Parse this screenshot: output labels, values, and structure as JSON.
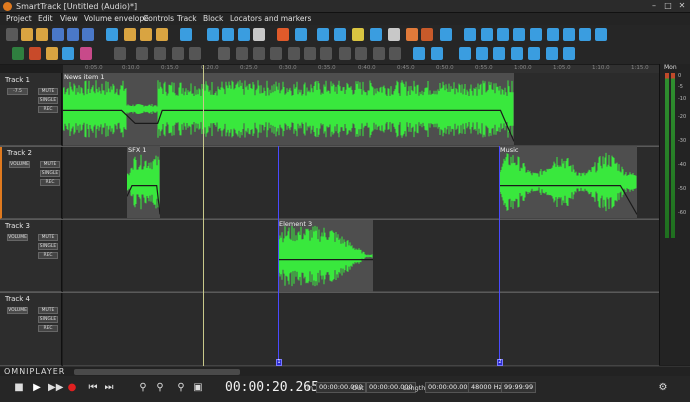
{
  "window": {
    "title": "SmartTrack [Untitled (Audio)*]"
  },
  "menu": [
    {
      "label": "Project"
    },
    {
      "label": "Edit"
    },
    {
      "label": "View"
    },
    {
      "label": "Volume envelope"
    },
    {
      "label": "Controls"
    },
    {
      "label": "Track"
    },
    {
      "label": "Block"
    },
    {
      "label": "Locators and markers"
    }
  ],
  "ruler": {
    "ticks": [
      "0:05.0",
      "0:10.0",
      "0:15.0",
      "0:20.0",
      "0:25.0",
      "0:30.0",
      "0:35.0",
      "0:40.0",
      "0:45.0",
      "0:50.0",
      "0:55.0",
      "1:00.0",
      "1:05.0",
      "1:10.0",
      "1:15.0"
    ]
  },
  "tracks": [
    {
      "name": "Track 1",
      "volume_label": "-7.5",
      "mute": "MUTE",
      "single": "SINGLE",
      "rec": "REC"
    },
    {
      "name": "Track 2",
      "volume_label": "VOLUME",
      "mute": "MUTE",
      "single": "SINGLE",
      "rec": "REC"
    },
    {
      "name": "Track 3",
      "volume_label": "VOLUME",
      "mute": "MUTE",
      "single": "SINGLE",
      "rec": "REC"
    },
    {
      "name": "Track 4",
      "volume_label": "VOLUME",
      "mute": "MUTE",
      "single": "SINGLE",
      "rec": "REC"
    }
  ],
  "clips": {
    "news": "News item 1",
    "sfx": "SFX 1",
    "music": "Music",
    "element": "Element 3"
  },
  "meter": {
    "title": "Mon",
    "scale": [
      "0",
      "-5",
      "-10",
      "-20",
      "-30",
      "-40",
      "-50",
      "-60"
    ]
  },
  "markers": [
    "1",
    "2"
  ],
  "brand": "OMNIPLAYER",
  "transport": {
    "timecode": "00:00:20.265",
    "in_label": "In",
    "in_value": "00:00:00.000",
    "out_label": "Out",
    "out_value": "00:00:00.000",
    "length_label": "Length",
    "length_value": "00:00:00.000",
    "sample_rate": "48000 Hz",
    "frames": "99:99:99"
  },
  "colors": {
    "waveform": "#39e83d",
    "accent": "#e07a1f",
    "playhead": "#c8c88a",
    "marker": "#4a4aff"
  }
}
